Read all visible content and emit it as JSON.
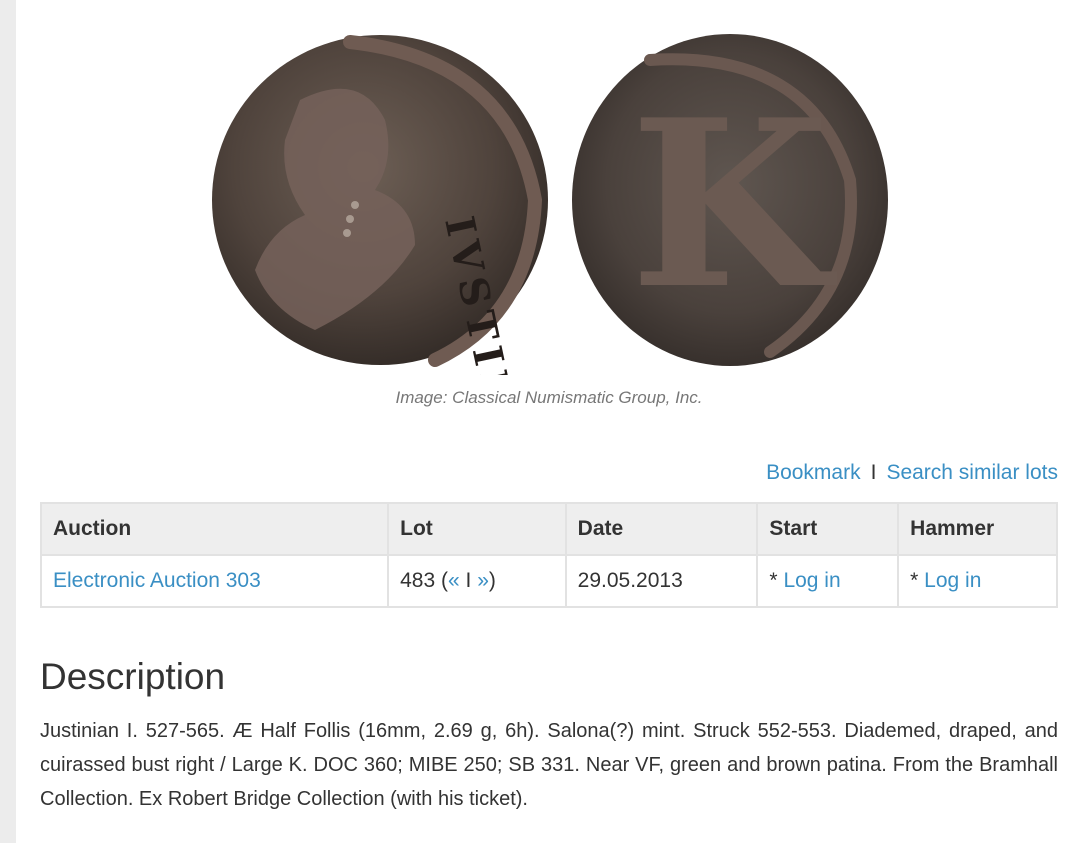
{
  "image": {
    "alt": "Justinian I Half Follis, obverse and reverse",
    "reverse_letter": "K",
    "legend_fragment": "IVSTINIAN",
    "caption": "Image: Classical Numismatic Group, Inc."
  },
  "actions": {
    "bookmark": "Bookmark",
    "separator": "I",
    "search_similar": "Search similar lots"
  },
  "table": {
    "headers": [
      "Auction",
      "Lot",
      "Date",
      "Start",
      "Hammer"
    ],
    "row": {
      "auction": "Electronic Auction 303",
      "lot_number": "483",
      "lot_open": "(",
      "lot_prev": "«",
      "lot_sep": "I",
      "lot_next": "»",
      "lot_close": ")",
      "date": "29.05.2013",
      "start_prefix": "* ",
      "start_link": "Log in",
      "hammer_prefix": "* ",
      "hammer_link": "Log in"
    }
  },
  "description": {
    "title": "Description",
    "text": "Justinian I. 527-565. Æ Half Follis (16mm, 2.69 g, 6h). Salona(?) mint. Struck 552-553. Diademed, draped, and cuirassed bust right / Large K. DOC 360; MIBE 250; SB 331. Near VF, green and brown patina. From the Bramhall Collection. Ex Robert Bridge Collection (with his ticket)."
  }
}
